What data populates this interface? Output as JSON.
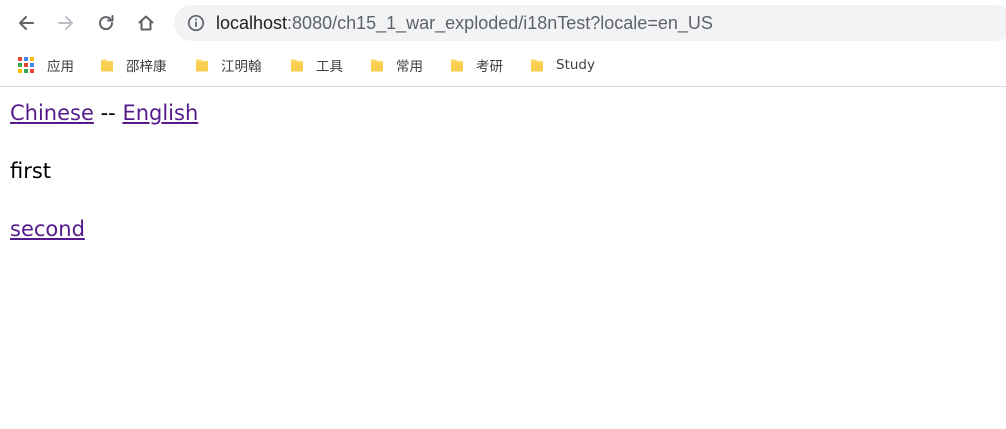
{
  "browser": {
    "url_host": "localhost",
    "url_rest": ":8080/ch15_1_war_exploded/i18nTest?locale=en_US",
    "nav": {
      "back_icon": "arrow-left-icon",
      "forward_icon": "arrow-right-icon",
      "reload_icon": "reload-icon",
      "home_icon": "home-icon",
      "info_icon": "info-icon"
    },
    "bookmarks": {
      "apps_label": "应用",
      "items": [
        {
          "label": "邵梓康",
          "icon": "folder-icon"
        },
        {
          "label": "江明翰",
          "icon": "folder-icon"
        },
        {
          "label": "工具",
          "icon": "folder-icon"
        },
        {
          "label": "常用",
          "icon": "folder-icon"
        },
        {
          "label": "考研",
          "icon": "folder-icon"
        },
        {
          "label": "Study",
          "icon": "folder-icon"
        }
      ]
    }
  },
  "page": {
    "chinese_link": "Chinese",
    "separator": "--",
    "english_link": "English",
    "first_text": "first",
    "second_link": "second"
  },
  "colors": {
    "visited_link": "#551a8b",
    "omnibox_bg": "#f1f3f4",
    "folder": "#fdd663"
  }
}
